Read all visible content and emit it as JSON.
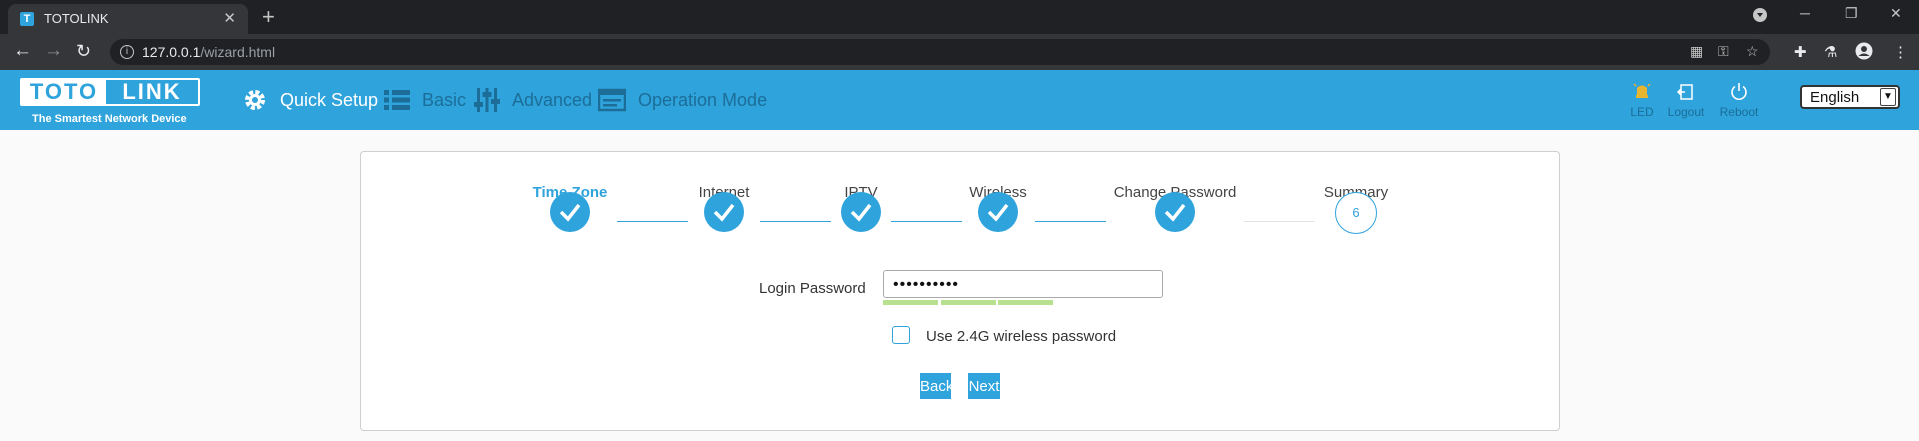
{
  "browser": {
    "tab_title": "TOTOLINK",
    "favicon_letter": "T",
    "url_host": "127.0.0.1",
    "url_path": "/wizard.html"
  },
  "header": {
    "logo_left": "TOTO",
    "logo_right": "LINK",
    "tagline": "The Smartest Network Device",
    "menu": [
      {
        "label": "Quick Setup",
        "icon": "gear-icon",
        "active": true
      },
      {
        "label": "Basic",
        "icon": "list-icon",
        "active": false
      },
      {
        "label": "Advanced",
        "icon": "sliders-icon",
        "active": false
      },
      {
        "label": "Operation Mode",
        "icon": "window-icon",
        "active": false
      }
    ],
    "tools": [
      {
        "label": "LED",
        "icon": "led-icon"
      },
      {
        "label": "Logout",
        "icon": "logout-icon"
      },
      {
        "label": "Reboot",
        "icon": "power-icon"
      }
    ],
    "language": "English"
  },
  "wizard": {
    "steps": [
      {
        "label": "Time Zone",
        "status": "done",
        "current": true
      },
      {
        "label": "Internet",
        "status": "done",
        "current": false
      },
      {
        "label": "IPTV",
        "status": "done",
        "current": false
      },
      {
        "label": "Wireless",
        "status": "done",
        "current": false
      },
      {
        "label": "Change Password",
        "status": "done",
        "current": false
      },
      {
        "label": "Summary",
        "status": "todo",
        "number": "6",
        "current": false
      }
    ],
    "password_label": "Login Password",
    "password_value": "••••••••••",
    "password_strength_segments": 3,
    "checkbox_label": "Use 2.4G wireless password",
    "checkbox_checked": false,
    "back_label": "Back",
    "next_label": "Next"
  },
  "colors": {
    "brand_blue": "#2ea3dc",
    "strength_green": "#b7e08f"
  }
}
